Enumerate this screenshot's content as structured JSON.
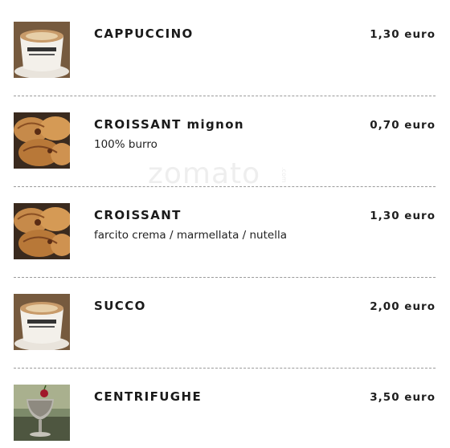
{
  "watermark": {
    "text": "zomato",
    "suffix": ".com"
  },
  "items": [
    {
      "name": "CAPPUCCINO",
      "description": "",
      "price": "1,30 euro",
      "image": "cappuccino-cup-image"
    },
    {
      "name": "CROISSANT mignon",
      "description": "100% burro",
      "price": "0,70 euro",
      "image": "croissant-image"
    },
    {
      "name": "CROISSANT",
      "description": "farcito crema / marmellata / nutella",
      "price": "1,30 euro",
      "image": "croissant-image"
    },
    {
      "name": "SUCCO",
      "description": "",
      "price": "2,00 euro",
      "image": "cappuccino-cup-image"
    },
    {
      "name": "CENTRIFUGHE",
      "description": "",
      "price": "3,50 euro",
      "image": "goblet-drink-image"
    }
  ]
}
